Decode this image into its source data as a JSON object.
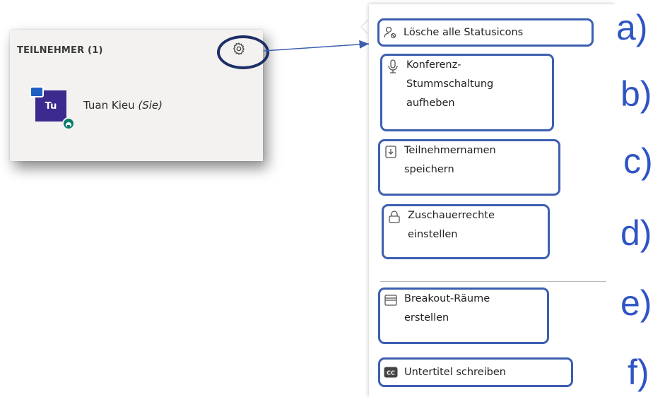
{
  "panel": {
    "title": "TEILNEHMER (1)",
    "participant": {
      "initials": "Tu",
      "name": "Tuan Kieu",
      "tag": "(Sie)"
    }
  },
  "menu": {
    "items": [
      {
        "icon": "clear-status-icon",
        "lines": [
          "Lösche alle Statusicons"
        ],
        "letter": "a)"
      },
      {
        "icon": "microphone-icon",
        "lines": [
          "Konferenz-",
          "Stummschaltung",
          "aufheben"
        ],
        "letter": "b)"
      },
      {
        "icon": "save-file-icon",
        "lines": [
          "Teilnehmernamen",
          "speichern"
        ],
        "letter": "c)"
      },
      {
        "icon": "lock-icon",
        "lines": [
          "Zuschauerrechte",
          "einstellen"
        ],
        "letter": "d)"
      },
      {
        "icon": "breakout-rooms-icon",
        "lines": [
          "Breakout-Räume",
          "erstellen"
        ],
        "letter": "e)"
      },
      {
        "icon": "closed-captions-icon",
        "lines": [
          "Untertitel schreiben"
        ],
        "letter": "f)"
      }
    ]
  },
  "colors": {
    "highlight": "#3d5fb0",
    "letters": "#2f55c4",
    "avatar": "#3c2a8e"
  }
}
